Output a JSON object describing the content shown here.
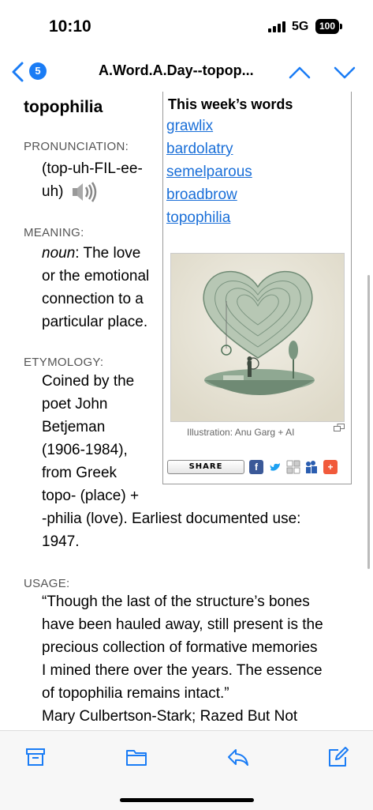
{
  "status": {
    "time": "10:10",
    "network": "5G",
    "battery": "100"
  },
  "nav": {
    "badge": "5",
    "title": "A.Word.A.Day--topop..."
  },
  "article": {
    "word": "topophilia",
    "pronunciation_label": "PRONUNCIATION:",
    "pronunciation_line1": "(top-uh-FIL-ee-",
    "pronunciation_line2": "uh)",
    "meaning_label": "MEANING:",
    "meaning_pos": "noun",
    "meaning_line1": ": The love",
    "meaning_line2": "or the emotional",
    "meaning_line3": "connection to a",
    "meaning_line4": "particular place.",
    "etymology_label": "ETYMOLOGY:",
    "etymology_lines": [
      "Coined by the",
      "poet John",
      "Betjeman",
      "(1906-1984),",
      "from Greek",
      "topo- (place) +",
      "-philia (love). Earliest documented use:",
      "1947."
    ],
    "usage_label": "USAGE:",
    "usage_lines": [
      "“Though the last of the structure’s bones",
      "have been hauled away, still present is the",
      "precious collection of formative memories",
      "I mined there over the years. The essence",
      "of topophilia remains intact.”",
      "Mary Culbertson-Stark; Razed But Not"
    ]
  },
  "sidebar": {
    "heading": "This week’s words",
    "links": [
      "grawlix",
      "bardolatry",
      "semelparous",
      "broadbrow",
      "topophilia"
    ],
    "caption": "Illustration: Anu Garg + AI",
    "share_label": "SHARE"
  },
  "colors": {
    "link": "#1a6fd8",
    "accent": "#1a7cf5",
    "facebook": "#3b5998",
    "twitter": "#1da1f2",
    "delicious": "#2a5db0",
    "addthis": "#f15a3b"
  }
}
